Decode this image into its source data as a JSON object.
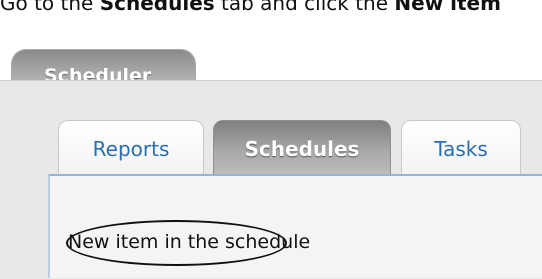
{
  "instruction": {
    "prefix": "Go to the ",
    "tab_name": "Schedules",
    "middle": " tab and click the ",
    "button_name": "New item"
  },
  "outer_tab": {
    "label": "Scheduler"
  },
  "inner_tabs": [
    {
      "label": "Reports",
      "selected": false
    },
    {
      "label": "Schedules",
      "selected": true
    },
    {
      "label": "Tasks",
      "selected": false
    }
  ],
  "content": {
    "new_item_label": "New item in the schedule"
  },
  "colors": {
    "tab_text_link": "#2a6fb0",
    "selected_tab_bg": "#9a9a9a",
    "content_border": "#8fb4e0",
    "highlight_ellipse": "#111111"
  }
}
